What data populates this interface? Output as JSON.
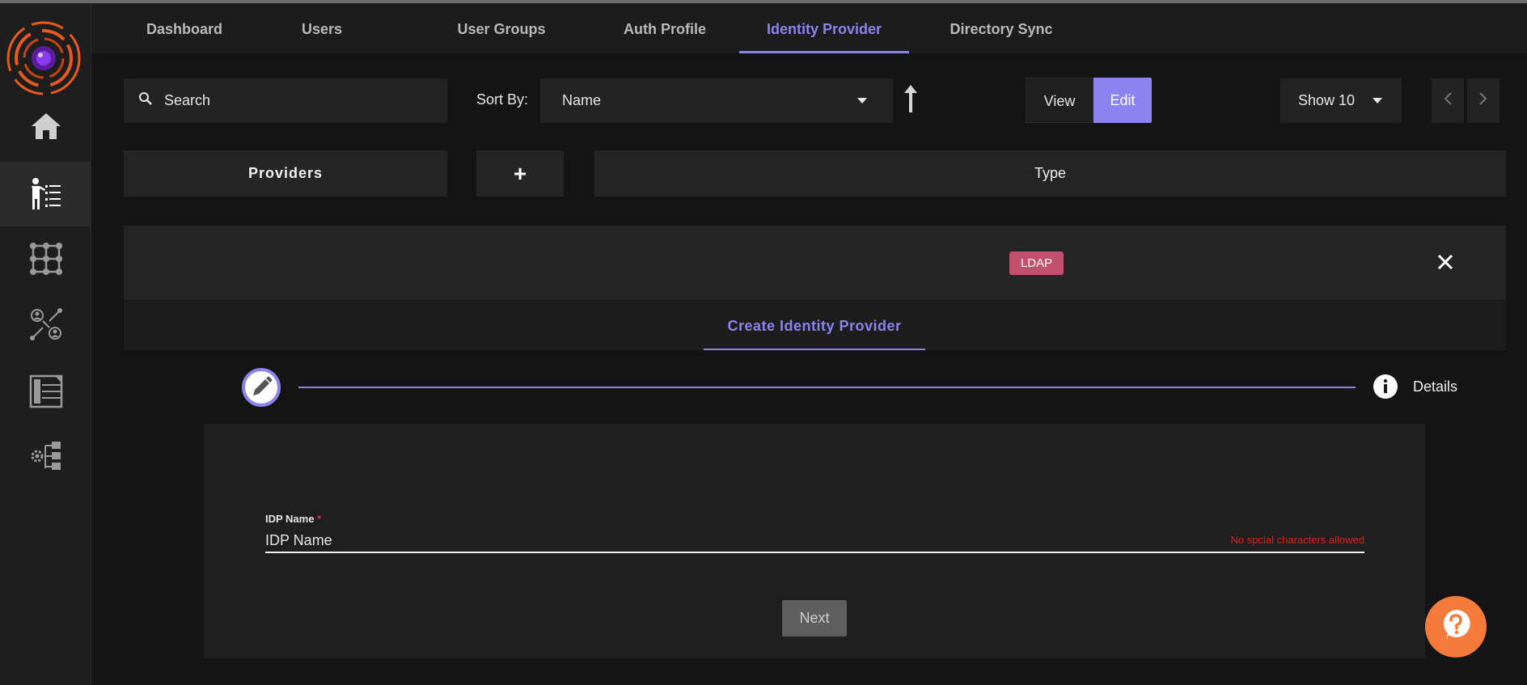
{
  "tabs": [
    {
      "label": "Dashboard"
    },
    {
      "label": "Users"
    },
    {
      "label": "User Groups"
    },
    {
      "label": "Auth Profile"
    },
    {
      "label": "Identity Provider"
    },
    {
      "label": "Directory Sync"
    }
  ],
  "active_tab": "Identity Provider",
  "sidebar": {
    "items": [
      {
        "icon": "home-icon"
      },
      {
        "icon": "identity-provider-icon",
        "active": true
      },
      {
        "icon": "grid-network-icon"
      },
      {
        "icon": "user-groups-network-icon"
      },
      {
        "icon": "table-list-icon"
      },
      {
        "icon": "settings-tree-icon"
      }
    ]
  },
  "toolbar": {
    "search_placeholder": "Search",
    "sort_label": "Sort By:",
    "sort_value": "Name",
    "view_label": "View",
    "edit_label": "Edit",
    "show_value": "Show 10"
  },
  "columns": {
    "providers": "Providers",
    "add": "+",
    "type": "Type"
  },
  "provider_row": {
    "badge": "LDAP"
  },
  "create": {
    "tab_label": "Create Identity Provider",
    "step_label": "Details",
    "field_label": "IDP Name",
    "field_required": "*",
    "field_placeholder": "IDP Name",
    "field_hint": "No spcial characters allowed",
    "next_label": "Next"
  },
  "colors": {
    "accent": "#8b84f0",
    "badge": "#c2506f",
    "help": "#f47b3a",
    "error": "#e02020"
  }
}
